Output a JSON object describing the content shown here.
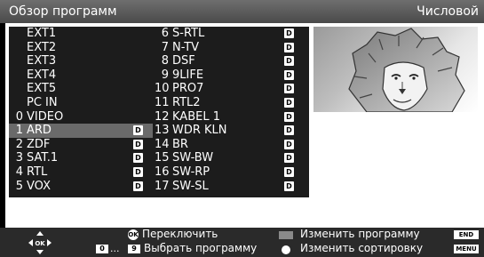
{
  "header": {
    "title": "Обзор программ",
    "sort_mode": "Числовой"
  },
  "channels": [
    {
      "num": "",
      "name": "EXT1",
      "d": false
    },
    {
      "num": "",
      "name": "EXT2",
      "d": false
    },
    {
      "num": "",
      "name": "EXT3",
      "d": false
    },
    {
      "num": "",
      "name": "EXT4",
      "d": false
    },
    {
      "num": "",
      "name": "EXT5",
      "d": false
    },
    {
      "num": "",
      "name": "PC IN",
      "d": false
    },
    {
      "num": "0",
      "name": "VIDEO",
      "d": false
    },
    {
      "num": "1",
      "name": "ARD",
      "d": true,
      "selected": true
    },
    {
      "num": "2",
      "name": "ZDF",
      "d": true
    },
    {
      "num": "3",
      "name": "SAT.1",
      "d": true
    },
    {
      "num": "4",
      "name": "RTL",
      "d": true
    },
    {
      "num": "5",
      "name": "VOX",
      "d": true
    },
    {
      "num": "6",
      "name": "S-RTL",
      "d": true
    },
    {
      "num": "7",
      "name": "N-TV",
      "d": true
    },
    {
      "num": "8",
      "name": "DSF",
      "d": true
    },
    {
      "num": "9",
      "name": "9LIFE",
      "d": true
    },
    {
      "num": "10",
      "name": "PRO7",
      "d": true
    },
    {
      "num": "11",
      "name": "RTL2",
      "d": true
    },
    {
      "num": "12",
      "name": "KABEL 1",
      "d": true
    },
    {
      "num": "13",
      "name": "WDR KLN",
      "d": true
    },
    {
      "num": "14",
      "name": "BR",
      "d": true
    },
    {
      "num": "15",
      "name": "SW-BW",
      "d": true
    },
    {
      "num": "16",
      "name": "SW-RP",
      "d": true
    },
    {
      "num": "17",
      "name": "SW-SL",
      "d": true
    }
  ],
  "badge_label": "D",
  "footer": {
    "ok_label": "OK",
    "switch_label": "Переключить",
    "digit_from": "0",
    "digit_ellipsis": "...",
    "digit_to": "9",
    "select_label": "Выбрать программу",
    "change_program_label": "Изменить программу",
    "change_sort_label": "Изменить сортировку",
    "end_key": "END",
    "menu_key": "MENU",
    "nav_ok": "OK"
  },
  "colors": {
    "title_bar": "#5a5a5a",
    "list_bg": "#1c1c1c",
    "selected_row": "#6a6a6a",
    "footer_bg": "#2a2a2a"
  }
}
